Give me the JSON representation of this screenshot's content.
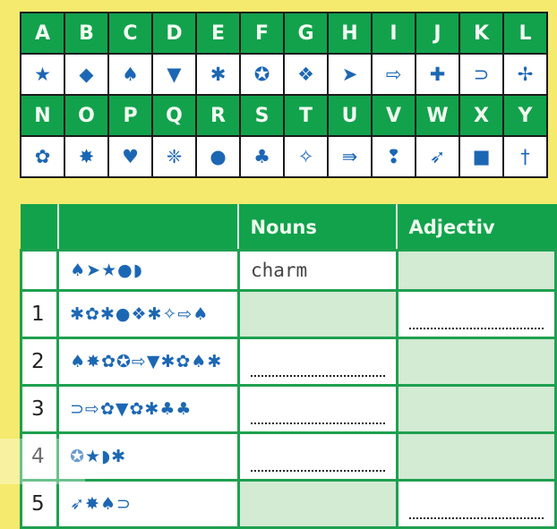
{
  "cipher_key": {
    "row1": [
      {
        "letter": "A",
        "symbol": "★",
        "icon": "star-icon"
      },
      {
        "letter": "B",
        "symbol": "◆",
        "icon": "diamond-icon"
      },
      {
        "letter": "C",
        "symbol": "♠",
        "icon": "spade-icon"
      },
      {
        "letter": "D",
        "symbol": "▼",
        "icon": "down-triangle-icon"
      },
      {
        "letter": "E",
        "symbol": "✱",
        "icon": "asterisk-icon"
      },
      {
        "letter": "F",
        "symbol": "✪",
        "icon": "circled-star-icon"
      },
      {
        "letter": "G",
        "symbol": "❖",
        "icon": "four-diamonds-icon"
      },
      {
        "letter": "H",
        "symbol": "➤",
        "icon": "arrowhead-icon"
      },
      {
        "letter": "I",
        "symbol": "⇨",
        "icon": "outline-arrow-icon"
      },
      {
        "letter": "J",
        "symbol": "✚",
        "icon": "dotted-cross-icon"
      },
      {
        "letter": "K",
        "symbol": "⊃",
        "icon": "horseshoe-icon"
      },
      {
        "letter": "L",
        "symbol": "✢",
        "icon": "four-point-cross-icon"
      }
    ],
    "row2": [
      {
        "letter": "N",
        "symbol": "✿",
        "icon": "flower-icon"
      },
      {
        "letter": "O",
        "symbol": "✸",
        "icon": "starburst-icon"
      },
      {
        "letter": "P",
        "symbol": "♥",
        "icon": "heart-icon"
      },
      {
        "letter": "Q",
        "symbol": "❈",
        "icon": "sparkle-icon"
      },
      {
        "letter": "R",
        "symbol": "●",
        "icon": "circle-icon"
      },
      {
        "letter": "S",
        "symbol": "♣",
        "icon": "club-icon"
      },
      {
        "letter": "T",
        "symbol": "✧",
        "icon": "four-point-star-icon"
      },
      {
        "letter": "U",
        "symbol": "⇛",
        "icon": "triple-arrow-icon"
      },
      {
        "letter": "V",
        "symbol": "❢",
        "icon": "exclamation-drop-icon"
      },
      {
        "letter": "W",
        "symbol": "➶",
        "icon": "arrow-up-right-icon"
      },
      {
        "letter": "X",
        "symbol": "■",
        "icon": "square-icon"
      },
      {
        "letter": "Y",
        "symbol": "†",
        "icon": "dagger-icon"
      }
    ]
  },
  "worksheet": {
    "headers": [
      "",
      "",
      "Nouns",
      "Adjectiv"
    ],
    "rows": [
      {
        "num": "",
        "code": "♠➤★●◗",
        "noun": "charm",
        "noun_blank": false,
        "adj_blank": false
      },
      {
        "num": "1",
        "code": "✱✿✱●❖✱✧⇨♠",
        "noun": "",
        "noun_blank": false,
        "adj_blank": true
      },
      {
        "num": "2",
        "code": "♠✸✿✪⇨▼✱✿♠✱",
        "noun": "",
        "noun_blank": true,
        "adj_blank": false
      },
      {
        "num": "3",
        "code": "⊃⇨✿▼✿✱♣♣",
        "noun": "",
        "noun_blank": true,
        "adj_blank": false
      },
      {
        "num": "4",
        "code": "✪★◗✱",
        "noun": "",
        "noun_blank": true,
        "adj_blank": false
      },
      {
        "num": "5",
        "code": "➶✸♠⊃",
        "noun": "",
        "noun_blank": false,
        "adj_blank": true
      }
    ]
  },
  "colors": {
    "background": "#f5ea6e",
    "green": "#12a24c",
    "symbol_blue": "#1c67b4",
    "shaded_cell": "#d3ead3"
  }
}
